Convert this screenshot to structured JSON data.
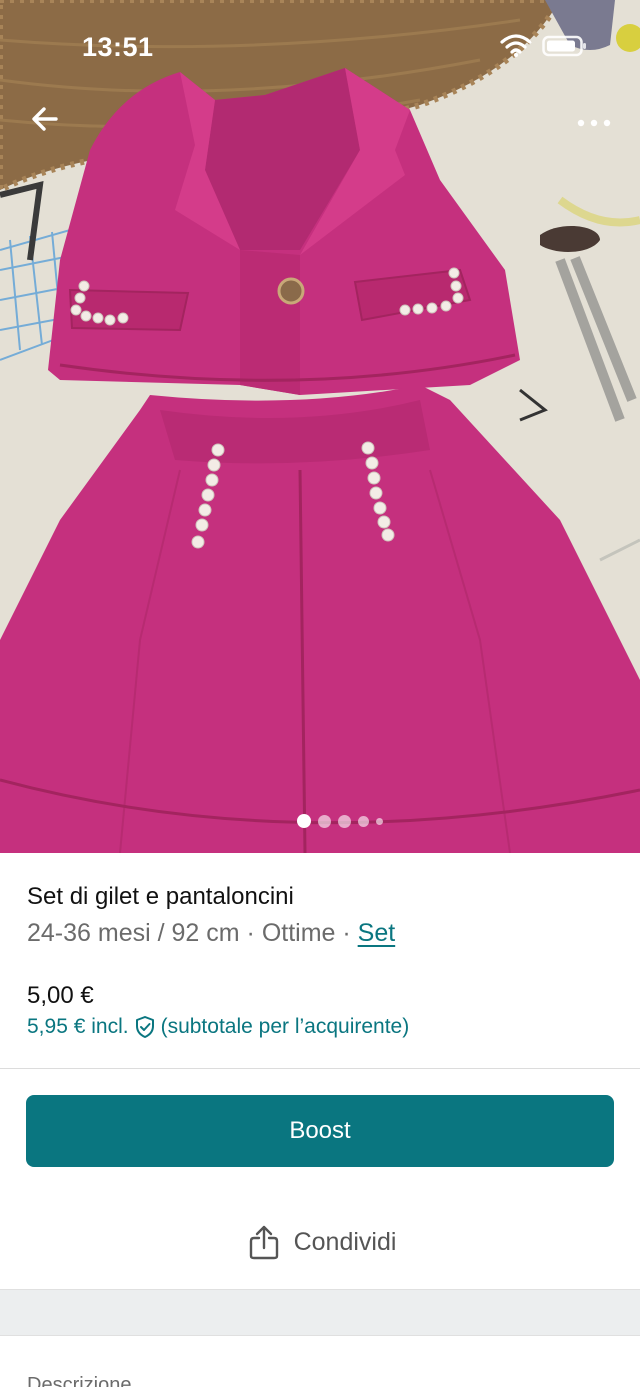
{
  "status_bar": {
    "time": "13:51"
  },
  "nav": {
    "back_icon": "arrow-left-icon",
    "more_icon": "more-horizontal-icon"
  },
  "gallery": {
    "image_count": 5,
    "active_index": 0
  },
  "item": {
    "title": "Set di gilet e pantaloncini",
    "size": "24-36 mesi / 92 cm",
    "separator": " · ",
    "condition": "Ottime",
    "category": "Set",
    "price": "5,00 €",
    "price_incl": "5,95 € incl.",
    "price_incl_note": "(subtotale per l’acquirente)"
  },
  "actions": {
    "boost_label": "Boost",
    "share_label": "Condividi"
  },
  "sections": {
    "description_label": "Descrizione"
  },
  "colors": {
    "accent": "#0a7680",
    "garment": "#c8317f",
    "text_primary": "#111111",
    "text_secondary": "#6b6b6b"
  }
}
